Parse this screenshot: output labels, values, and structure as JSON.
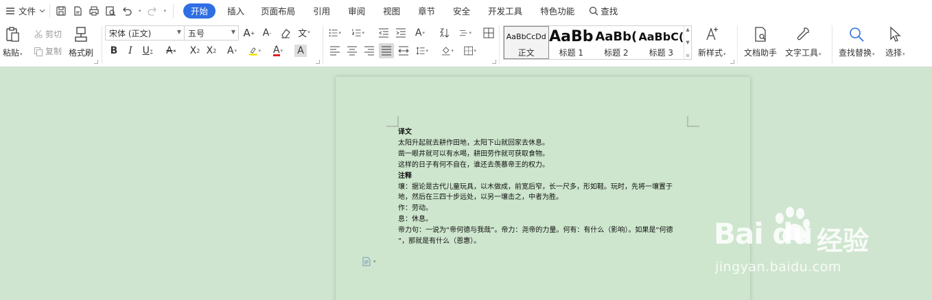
{
  "menubar": {
    "file_label": "文件",
    "tabs": [
      {
        "label": "开始",
        "active": true
      },
      {
        "label": "插入",
        "active": false
      },
      {
        "label": "页面布局",
        "active": false
      },
      {
        "label": "引用",
        "active": false
      },
      {
        "label": "审阅",
        "active": false
      },
      {
        "label": "视图",
        "active": false
      },
      {
        "label": "章节",
        "active": false
      },
      {
        "label": "安全",
        "active": false
      },
      {
        "label": "开发工具",
        "active": false
      },
      {
        "label": "特色功能",
        "active": false
      }
    ],
    "search_label": "查找",
    "accent_color": "#2f6fe3"
  },
  "ribbon": {
    "clipboard": {
      "paste_label": "粘贴",
      "cut_label": "剪切",
      "copy_label": "复制",
      "format_painter_label": "格式刷"
    },
    "font": {
      "font_name": "宋体 (正文)",
      "font_size": "五号"
    },
    "styles": [
      {
        "sample": "AaBbCcDd",
        "name": "正文",
        "selected": true
      },
      {
        "sample": "AaBb",
        "name": "标题 1",
        "selected": false
      },
      {
        "sample": "AaBb(",
        "name": "标题 2",
        "selected": false
      },
      {
        "sample": "AaBbC(",
        "name": "标题 3",
        "selected": false
      }
    ],
    "new_style_label": "新样式",
    "doc_assistant_label": "文档助手",
    "text_tools_label": "文字工具",
    "find_replace_label": "查找替换",
    "select_label": "选择"
  },
  "document": {
    "lines": [
      "译文",
      "太阳升起就去耕作田地，太阳下山就回家去休息。",
      "凿一眼井就可以有水喝，耕田劳作就可获取食物。",
      "这样的日子有何不自在，谁还去羡慕帝王的权力。",
      "注释",
      "壤：据论是古代儿童玩具，以木做成，前宽后窄，长一尺多，形如鞋。玩时，先将一壤置于",
      "地，然后在三四十步远处，以另一壤击之，中者为胜。",
      "作：劳动。",
      "息：休息。",
      "帝力句：一说为“帝何德与我哉”。帝力：尧帝的力量。何有：有什么（影响）。如果是“何德",
      "”，那就是有什么（恩惠）。"
    ],
    "page_color": "#cde6cd",
    "background_color": "#cfe5cf"
  },
  "watermark": {
    "logo_text": "Bai du",
    "cn_text": "经验",
    "url_text": "jingyan.baidu.com"
  }
}
